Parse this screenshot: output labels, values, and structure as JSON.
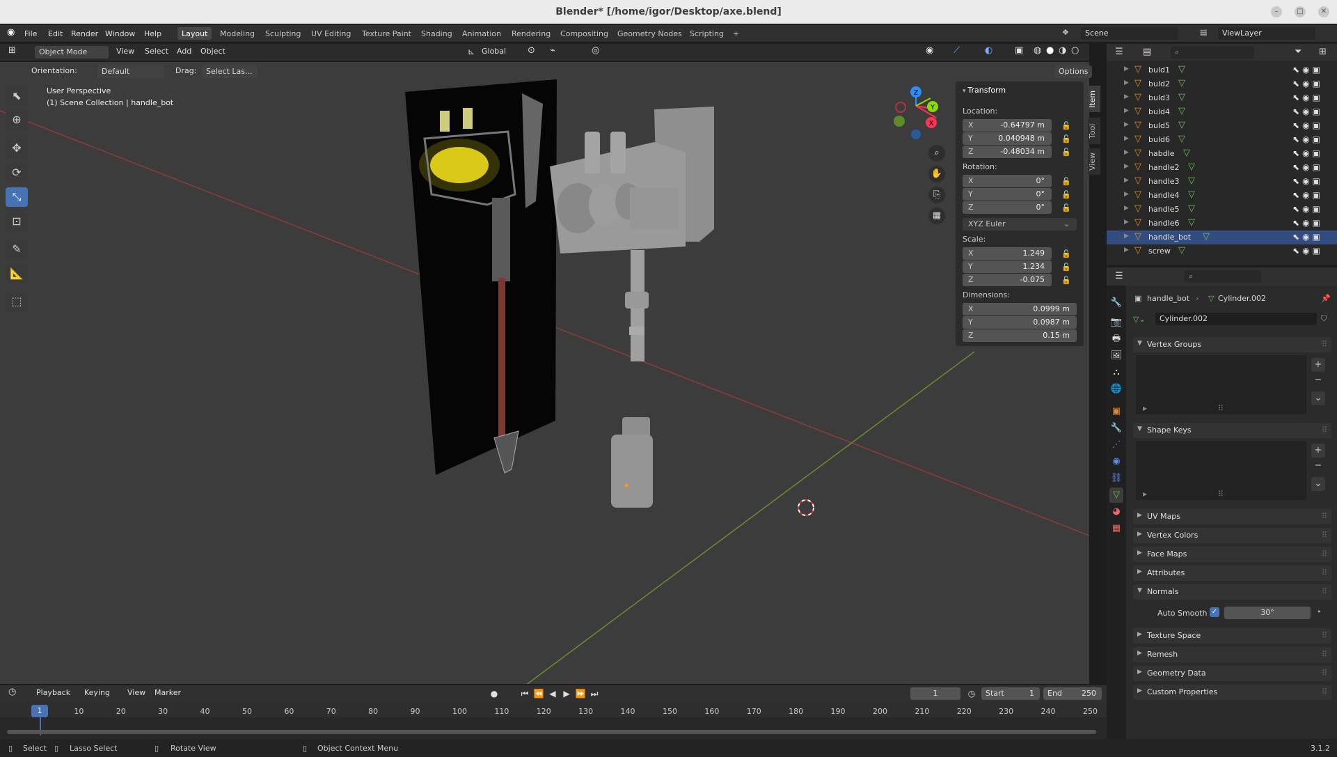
{
  "window": {
    "title": "Blender* [/home/igor/Desktop/axe.blend]"
  },
  "menu": {
    "file": "File",
    "edit": "Edit",
    "render": "Render",
    "window": "Window",
    "help": "Help"
  },
  "workspaces": [
    "Layout",
    "Modeling",
    "Sculpting",
    "UV Editing",
    "Texture Paint",
    "Shading",
    "Animation",
    "Rendering",
    "Compositing",
    "Geometry Nodes",
    "Scripting",
    "+"
  ],
  "scene": {
    "name": "Scene",
    "view_layer": "ViewLayer"
  },
  "viewport_header": {
    "mode": "Object Mode",
    "view": "View",
    "select": "Select",
    "add": "Add",
    "object": "Object",
    "transform_orientation": "Global"
  },
  "tool_settings": {
    "orientation_label": "Orientation:",
    "orientation_value": "Default",
    "drag_label": "Drag:",
    "drag_value": "Select Las...",
    "options": "Options"
  },
  "viewport": {
    "perspective": "User Perspective",
    "collection": "(1) Scene Collection | handle_bot"
  },
  "npanel": {
    "tabs": [
      "Item",
      "Tool",
      "View"
    ],
    "transform_title": "Transform",
    "location_label": "Location:",
    "location": {
      "x": "-0.64797 m",
      "y": "0.040948 m",
      "z": "-0.48034 m"
    },
    "rotation_label": "Rotation:",
    "rotation": {
      "x": "0°",
      "y": "0°",
      "z": "0°"
    },
    "rotation_mode": "XYZ Euler",
    "scale_label": "Scale:",
    "scale": {
      "x": "1.249",
      "y": "1.234",
      "z": "-0.075"
    },
    "dimensions_label": "Dimensions:",
    "dimensions": {
      "x": "0.0999 m",
      "y": "0.0987 m",
      "z": "0.15 m"
    },
    "axes": {
      "x": "X",
      "y": "Y",
      "z": "Z"
    }
  },
  "outliner": {
    "items": [
      {
        "name": "buld1"
      },
      {
        "name": "buld2"
      },
      {
        "name": "buld3"
      },
      {
        "name": "buld4"
      },
      {
        "name": "buld5"
      },
      {
        "name": "buld6"
      },
      {
        "name": "habdle"
      },
      {
        "name": "handle2"
      },
      {
        "name": "handle3"
      },
      {
        "name": "handle4"
      },
      {
        "name": "handle5"
      },
      {
        "name": "handle6"
      },
      {
        "name": "handle_bot"
      },
      {
        "name": "screw"
      }
    ]
  },
  "properties": {
    "breadcrumb_object": "handle_bot",
    "breadcrumb_data": "Cylinder.002",
    "mesh_name": "Cylinder.002",
    "sections": {
      "vertex_groups": "Vertex Groups",
      "shape_keys": "Shape Keys",
      "uv_maps": "UV Maps",
      "vertex_colors": "Vertex Colors",
      "face_maps": "Face Maps",
      "attributes": "Attributes",
      "normals": "Normals",
      "texture_space": "Texture Space",
      "remesh": "Remesh",
      "geometry_data": "Geometry Data",
      "custom_properties": "Custom Properties"
    },
    "auto_smooth_label": "Auto Smooth",
    "auto_smooth_angle": "30°"
  },
  "timeline": {
    "playback": "Playback",
    "keying": "Keying",
    "view": "View",
    "marker": "Marker",
    "current_frame": "1",
    "start_label": "Start",
    "start": "1",
    "end_label": "End",
    "end": "250",
    "ticks": [
      "1",
      "10",
      "20",
      "30",
      "40",
      "50",
      "60",
      "70",
      "80",
      "90",
      "100",
      "110",
      "120",
      "130",
      "140",
      "150",
      "160",
      "170",
      "180",
      "190",
      "200",
      "210",
      "220",
      "230",
      "240",
      "250"
    ]
  },
  "statusbar": {
    "select": "Select",
    "lasso": "Lasso Select",
    "rotate": "Rotate View",
    "context": "Object Context Menu",
    "version": "3.1.2"
  },
  "colors": {
    "accent": "#4772b3",
    "x_axis": "#ff3352",
    "y_axis": "#8bdc00",
    "z_axis": "#2890ff",
    "object_orange": "#e88b2c",
    "mesh_green": "#6fc15a"
  }
}
